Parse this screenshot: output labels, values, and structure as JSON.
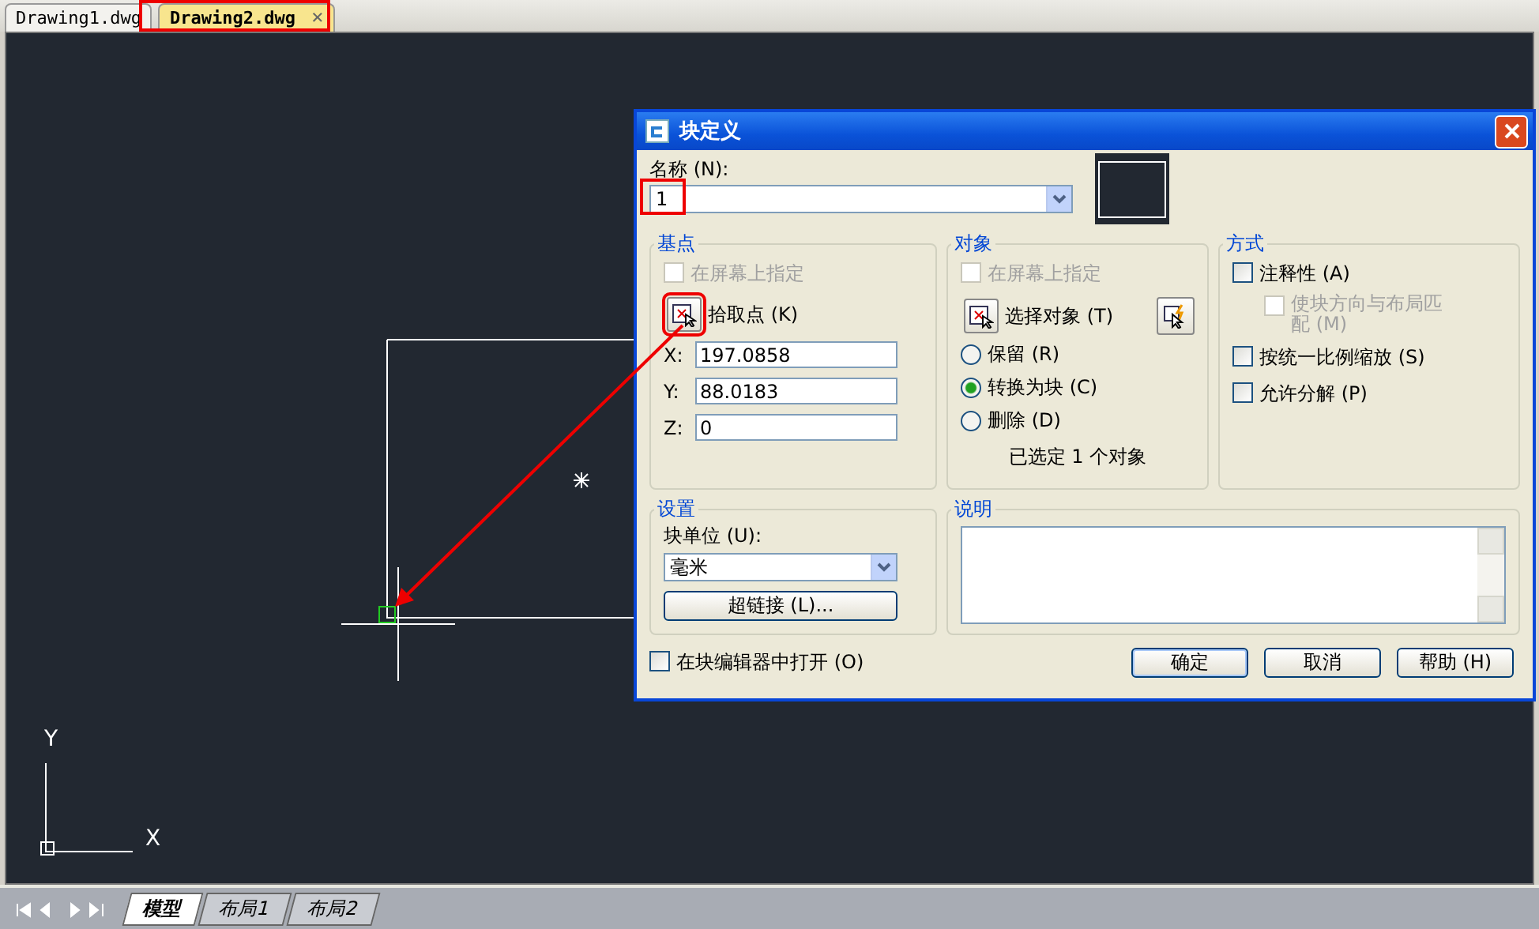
{
  "file_tabs": [
    {
      "label": "Drawing1.dwg",
      "selected": false
    },
    {
      "label": "Drawing2.dwg",
      "selected": true,
      "close": "×"
    }
  ],
  "canvas": {
    "ucs_y": "Y",
    "ucs_x": "X"
  },
  "layout_tabs": [
    {
      "label": "模型",
      "selected": true
    },
    {
      "label": "布局1",
      "selected": false
    },
    {
      "label": "布局2",
      "selected": false
    }
  ],
  "dialog": {
    "title": "块定义",
    "name_label": "名称 (N):",
    "name_value": "1",
    "base_point": {
      "title": "基点",
      "specify_on_screen": {
        "label": "在屏幕上指定",
        "checked": false,
        "disabled": true
      },
      "pick_label": "拾取点 (K)",
      "coords": [
        {
          "label": "X:",
          "value": "197.0858"
        },
        {
          "label": "Y:",
          "value": "88.0183"
        },
        {
          "label": "Z:",
          "value": "0"
        }
      ]
    },
    "objects": {
      "title": "对象",
      "specify_on_screen": {
        "label": "在屏幕上指定",
        "checked": false,
        "disabled": true
      },
      "select_label": "选择对象 (T)",
      "options": [
        {
          "label": "保留 (R)",
          "selected": false
        },
        {
          "label": "转换为块 (C)",
          "selected": true
        },
        {
          "label": "删除 (D)",
          "selected": false
        }
      ],
      "status": "已选定 1 个对象"
    },
    "behavior": {
      "title": "方式",
      "options": [
        {
          "label": "注释性 (A)",
          "checked": false,
          "disabled": false,
          "children": [
            {
              "label": "使块方向与布局匹配 (M)",
              "checked": false,
              "disabled": true
            }
          ]
        },
        {
          "label": "按统一比例缩放 (S)",
          "checked": false,
          "disabled": false
        },
        {
          "label": "允许分解 (P)",
          "checked": false,
          "disabled": false
        }
      ]
    },
    "settings": {
      "title": "设置",
      "unit_label": "块单位 (U):",
      "unit_value": "毫米",
      "hyperlink": "超链接 (L)..."
    },
    "description": {
      "title": "说明"
    },
    "open_in_editor": {
      "label": "在块编辑器中打开 (O)",
      "checked": false
    },
    "buttons": [
      {
        "label": "确定",
        "default": true
      },
      {
        "label": "取消",
        "default": false
      },
      {
        "label": "帮助 (H)",
        "default": false
      }
    ]
  }
}
